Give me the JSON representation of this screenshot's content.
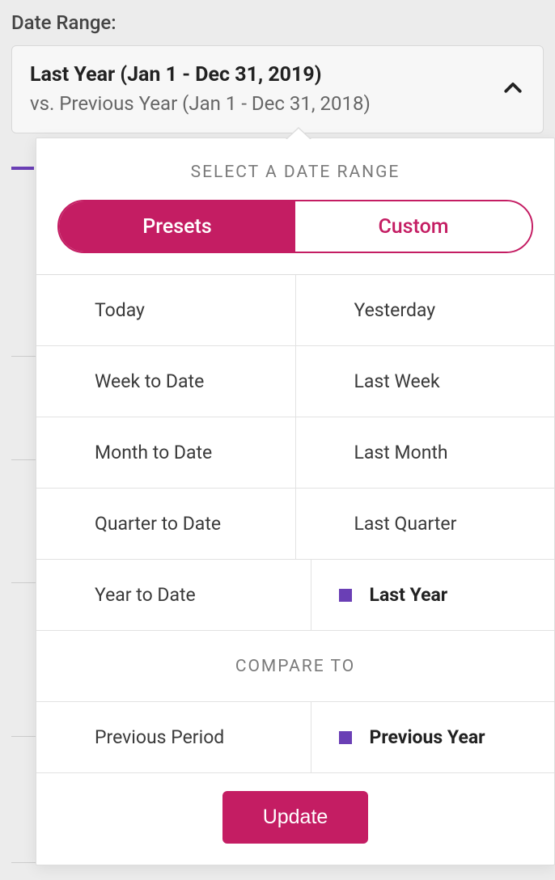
{
  "field_label": "Date Range:",
  "selector": {
    "title": "Last Year (Jan 1 - Dec 31, 2019)",
    "subtitle": "vs. Previous Year (Jan 1 - Dec 31, 2018)"
  },
  "popover": {
    "title": "SELECT A DATE RANGE",
    "tabs": {
      "presets": "Presets",
      "custom": "Custom",
      "active": "presets"
    },
    "presets": [
      {
        "left": "Today",
        "right": "Yesterday",
        "selected": null
      },
      {
        "left": "Week to Date",
        "right": "Last Week",
        "selected": null
      },
      {
        "left": "Month to Date",
        "right": "Last Month",
        "selected": null
      },
      {
        "left": "Quarter to Date",
        "right": "Last Quarter",
        "selected": null
      },
      {
        "left": "Year to Date",
        "right": "Last Year",
        "selected": "right"
      }
    ],
    "compare_label": "COMPARE TO",
    "compare": {
      "left": "Previous Period",
      "right": "Previous Year",
      "selected": "right"
    },
    "update_label": "Update"
  },
  "colors": {
    "accent": "#c41d63",
    "selected_marker": "#6a3fb5"
  }
}
